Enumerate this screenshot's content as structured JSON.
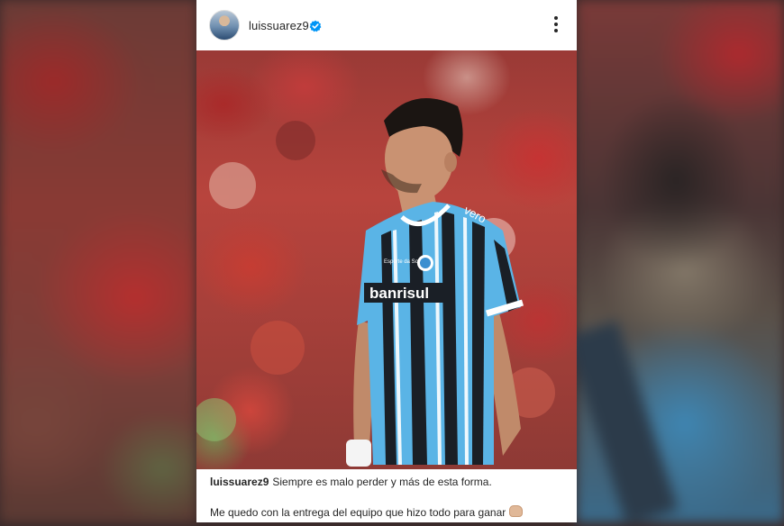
{
  "post": {
    "header": {
      "username": "luissuarez9",
      "verified_icon": "verified-badge-icon",
      "more_icon": "more-options-icon"
    },
    "photo": {
      "jersey_sponsor": "banrisul",
      "jersey_brand": "vero",
      "jersey_small_text": "Esporte da Sorte"
    },
    "caption": {
      "username": "luissuarez9",
      "line1": "Siempre es malo perder y más de esta forma.",
      "line2": "Me quedo con la entrega del equipo que hizo todo para ganar",
      "emoji_icon": "raised-fist-icon"
    }
  },
  "colors": {
    "verified_blue": "#0095f6",
    "jersey_blue": "#5ab4e6",
    "jersey_black": "#1a1f26",
    "stadium_red": "#b8443d"
  }
}
